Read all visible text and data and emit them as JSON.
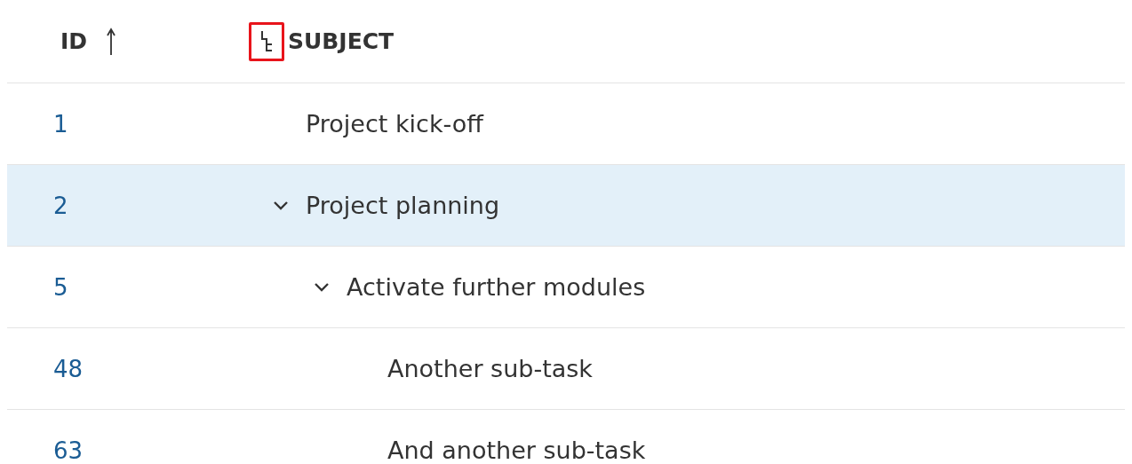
{
  "table": {
    "columns": [
      {
        "label": "ID",
        "kind": "sort"
      },
      {
        "label": "SUBJECT",
        "kind": "hierarchy"
      }
    ],
    "rows": [
      {
        "id": "1",
        "subject": "Project kick-off",
        "selected": false
      },
      {
        "id": "2",
        "subject": "Project planning",
        "selected": true,
        "expanded": true,
        "children": [
          {
            "id": "5",
            "subject": "Activate further modules",
            "selected": false,
            "expanded": true,
            "children": [
              {
                "id": "48",
                "subject": "Another sub-task",
                "selected": false
              },
              {
                "id": "63",
                "subject": "And another sub-task",
                "selected": false
              }
            ]
          }
        ]
      }
    ]
  }
}
